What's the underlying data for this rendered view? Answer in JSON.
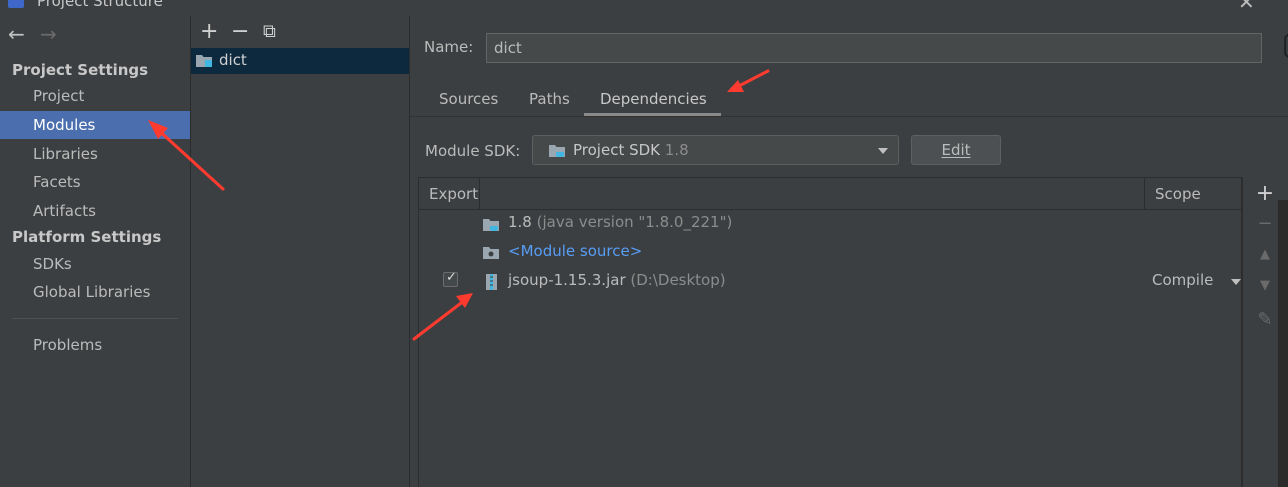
{
  "window": {
    "title": "Project Structure"
  },
  "sidebar": {
    "nav": {
      "back": "←",
      "forward": "→"
    },
    "project_settings_header": "Project Settings",
    "project_settings_items": [
      "Project",
      "Modules",
      "Libraries",
      "Facets",
      "Artifacts"
    ],
    "platform_settings_header": "Platform Settings",
    "platform_settings_items": [
      "SDKs",
      "Global Libraries"
    ],
    "problems": "Problems",
    "selected": "Modules"
  },
  "modules_panel": {
    "toolbar": {
      "add": "+",
      "remove": "−",
      "copy": "⧉"
    },
    "modules": [
      {
        "name": "dict",
        "selected": true
      }
    ]
  },
  "module": {
    "name_label": "Name:",
    "name_value": "dict",
    "tabs": [
      "Sources",
      "Paths",
      "Dependencies"
    ],
    "active_tab": "Dependencies",
    "sdk_label": "Module SDK:",
    "sdk_value": "Project SDK",
    "sdk_version": "1.8",
    "edit_button": "Edit"
  },
  "dependencies_table": {
    "columns": {
      "export": "Export",
      "scope": "Scope"
    },
    "rows": [
      {
        "name": "1.8",
        "detail": "(java version \"1.8.0_221\")",
        "icon": "jdk-folder-icon",
        "checkbox": false,
        "scope": ""
      },
      {
        "name": "<Module source>",
        "detail": "",
        "icon": "module-source-icon",
        "checkbox": false,
        "scope": ""
      },
      {
        "name": "jsoup-1.15.3.jar",
        "detail": "(D:\\Desktop)",
        "icon": "jar-icon",
        "checkbox": true,
        "checked": true,
        "scope": "Compile"
      }
    ],
    "side_toolbar": [
      "add-icon",
      "remove-icon",
      "move-up-icon",
      "move-down-icon",
      "edit-pencil-icon"
    ]
  },
  "colors": {
    "selection": "#4b6eaf",
    "annotation_arrow": "#ff3b30",
    "link": "#589df6"
  }
}
